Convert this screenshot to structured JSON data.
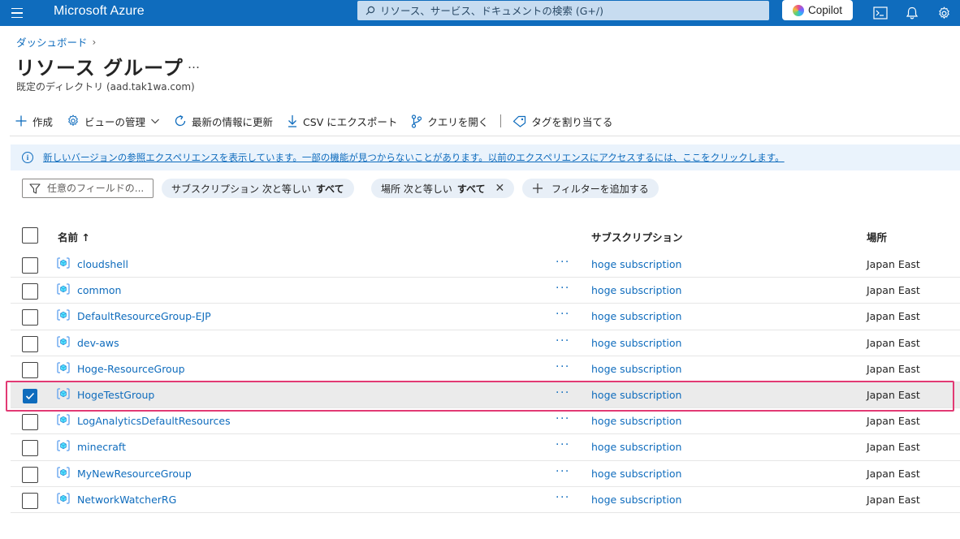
{
  "topbar": {
    "brand": "Microsoft Azure",
    "search_placeholder": "リソース、サービス、ドキュメントの検索 (G+/)",
    "copilot_label": "Copilot"
  },
  "header": {
    "breadcrumb": "ダッシュボード",
    "title": "リソース グループ",
    "more": "…",
    "subtitle": "既定のディレクトリ (aad.tak1wa.com)"
  },
  "toolbar": {
    "create": "作成",
    "manage_view": "ビューの管理",
    "refresh": "最新の情報に更新",
    "export_csv": "CSV にエクスポート",
    "open_query": "クエリを開く",
    "assign_tags": "タグを割り当てる"
  },
  "banner": {
    "text": "新しいバージョンの参照エクスペリエンスを表示しています。一部の機能が見つからないことがあります。以前のエクスペリエンスにアクセスするには、ここをクリックします。"
  },
  "filters": {
    "field_placeholder": "任意のフィールドの...",
    "subscription_label": "サブスクリプション 次と等しい",
    "subscription_value": "すべて",
    "location_label": "場所 次と等しい",
    "location_value": "すべて",
    "add_filter": "フィルターを追加する"
  },
  "table": {
    "columns": {
      "name": "名前 ↑",
      "subscription": "サブスクリプション",
      "location": "場所"
    },
    "more_label": "···",
    "rows": [
      {
        "name": "cloudshell",
        "subscription": "hoge subscription",
        "location": "Japan East",
        "selected": false
      },
      {
        "name": "common",
        "subscription": "hoge subscription",
        "location": "Japan East",
        "selected": false
      },
      {
        "name": "DefaultResourceGroup-EJP",
        "subscription": "hoge subscription",
        "location": "Japan East",
        "selected": false
      },
      {
        "name": "dev-aws",
        "subscription": "hoge subscription",
        "location": "Japan East",
        "selected": false
      },
      {
        "name": "Hoge-ResourceGroup",
        "subscription": "hoge subscription",
        "location": "Japan East",
        "selected": false
      },
      {
        "name": "HogeTestGroup",
        "subscription": "hoge subscription",
        "location": "Japan East",
        "selected": true
      },
      {
        "name": "LogAnalyticsDefaultResources",
        "subscription": "hoge subscription",
        "location": "Japan East",
        "selected": false
      },
      {
        "name": "minecraft",
        "subscription": "hoge subscription",
        "location": "Japan East",
        "selected": false
      },
      {
        "name": "MyNewResourceGroup",
        "subscription": "hoge subscription",
        "location": "Japan East",
        "selected": false
      },
      {
        "name": "NetworkWatcherRG",
        "subscription": "hoge subscription",
        "location": "Japan East",
        "selected": false
      }
    ]
  },
  "colors": {
    "brand_blue": "#0f6cbd",
    "selection_highlight": "#e23a74",
    "selected_row": "#ebebeb"
  },
  "icons": [
    "menu-icon",
    "search-icon",
    "copilot-icon",
    "cloud-shell-icon",
    "notifications-icon",
    "settings-icon",
    "plus-icon",
    "gear-icon",
    "chevron-down-icon",
    "refresh-icon",
    "download-icon",
    "query-icon",
    "tag-icon",
    "info-icon",
    "filter-icon",
    "close-icon",
    "resource-group-icon",
    "checkmark-icon"
  ]
}
